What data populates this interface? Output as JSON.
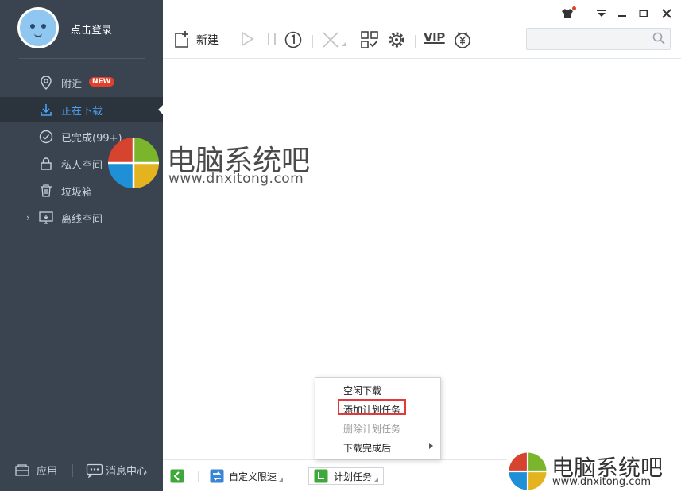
{
  "sidebar": {
    "login_text": "点击登录",
    "items": [
      {
        "label": "附近",
        "icon": "location-pin-icon",
        "badge": "NEW"
      },
      {
        "label": "正在下载",
        "icon": "download-arrow-icon",
        "active": true
      },
      {
        "label": "已完成(99+)",
        "icon": "check-circle-icon"
      },
      {
        "label": "私人空间",
        "icon": "lock-icon"
      },
      {
        "label": "垃圾箱",
        "icon": "trash-icon"
      },
      {
        "label": "离线空间",
        "icon": "cloud-monitor-icon"
      }
    ],
    "bottom": {
      "apps_label": "应用",
      "messages_label": "消息中心"
    }
  },
  "toolbar": {
    "new_label": "新建",
    "vip_label": "VIP",
    "search_placeholder": ""
  },
  "statusbar": {
    "speed_label": "自定义限速",
    "schedule_label": "计划任务"
  },
  "context_menu": {
    "items": [
      {
        "label": "空闲下载"
      },
      {
        "label": "添加计划任务",
        "highlighted": true
      },
      {
        "label": "删除计划任务",
        "disabled": true
      },
      {
        "label": "下载完成后",
        "submenu": true
      }
    ]
  },
  "watermark": {
    "title": "电脑系统吧",
    "url": "www.dnxitong.com"
  },
  "colors": {
    "sidebar_bg": "#3a4450",
    "active_text": "#4ba3f2",
    "badge_red": "#e0412c",
    "highlight_border": "#e23a3a"
  }
}
